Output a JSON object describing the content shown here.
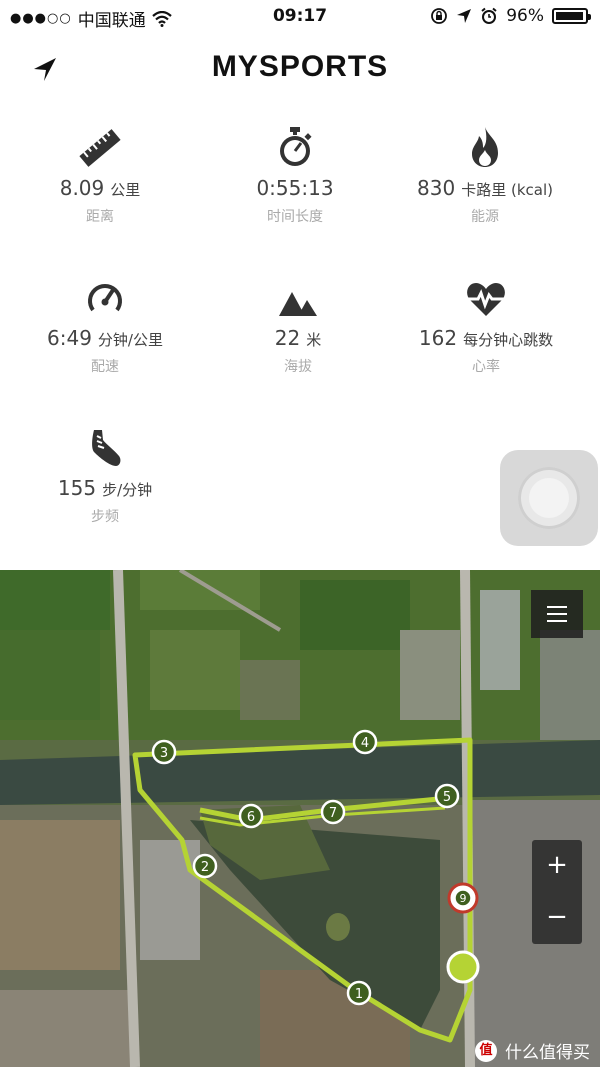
{
  "status_bar": {
    "carrier": "中国联通",
    "time": "09:17",
    "battery": "96%",
    "battery_level": 0.96
  },
  "header": {
    "title": "MYSPORTS"
  },
  "stats": [
    {
      "icon": "ruler-icon",
      "value": "8.09",
      "unit": "公里",
      "label": "距离"
    },
    {
      "icon": "stopwatch-icon",
      "value": "0:55:13",
      "unit": "",
      "label": "时间长度"
    },
    {
      "icon": "flame-icon",
      "value": "830",
      "unit": "卡路里 (kcal)",
      "label": "能源"
    },
    {
      "icon": "speedometer-icon",
      "value": "6:49",
      "unit": "分钟/公里",
      "label": "配速"
    },
    {
      "icon": "mountain-icon",
      "value": "22",
      "unit": "米",
      "label": "海拔"
    },
    {
      "icon": "heartbeat-icon",
      "value": "162",
      "unit": "每分钟心跳数",
      "label": "心率"
    },
    {
      "icon": "shoe-icon",
      "value": "155",
      "unit": "步/分钟",
      "label": "步频"
    }
  ],
  "map": {
    "markers": [
      "1",
      "2",
      "3",
      "4",
      "5",
      "6",
      "7",
      "9"
    ],
    "zoom_in": "+",
    "zoom_out": "−",
    "route_color": "#b5d334"
  },
  "watermark": {
    "badge": "值",
    "text": "什么值得买"
  }
}
